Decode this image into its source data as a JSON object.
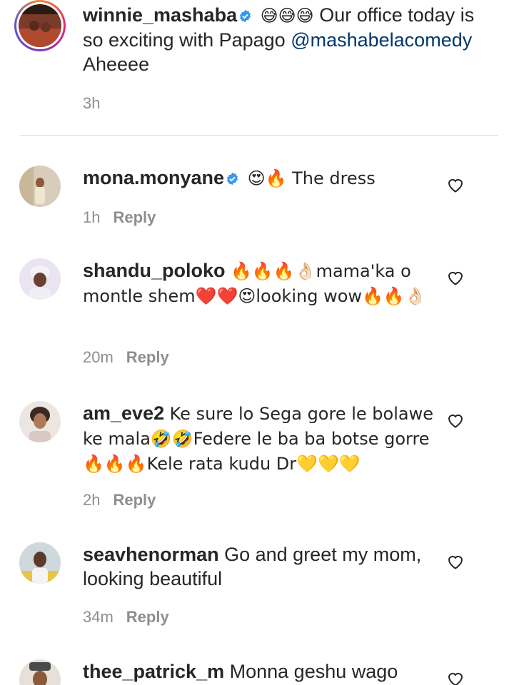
{
  "caption": {
    "username": "winnie_mashaba",
    "emojis": "😅😅😅",
    "text_before_mention": "Our office today is so exciting with Papago",
    "mention": "@mashabelacomedy",
    "text_after_mention": "Aheeee",
    "time": "3h",
    "verified": true
  },
  "comments": [
    {
      "username": "mona.monyane",
      "verified": true,
      "text": "😍🔥 The dress",
      "time": "1h",
      "reply_label": "Reply"
    },
    {
      "username": "shandu_poloko",
      "verified": false,
      "text": "🔥🔥🔥👌🏻mama'ka o montle shem❤️❤️😍looking wow🔥🔥👌🏻",
      "time": "20m",
      "reply_label": "Reply"
    },
    {
      "username": "am_eve2",
      "verified": false,
      "text": "Ke sure lo Sega gore le bolawe ke mala🤣🤣Federe le ba ba botse gorre 🔥🔥🔥Kele rata kudu Dr💛💛💛",
      "time": "2h",
      "reply_label": "Reply"
    },
    {
      "username": "seavhenorman",
      "verified": false,
      "text": "Go and greet my mom, looking beautiful",
      "time": "34m",
      "reply_label": "Reply"
    },
    {
      "username": "thee_patrick_m",
      "verified": false,
      "text": "Monna geshu wago",
      "time": "",
      "reply_label": ""
    }
  ],
  "colors": {
    "verified_blue": "#3897f0",
    "muted": "#8e8e8e",
    "mention": "#00376b"
  },
  "icons": {
    "like": "heart-outline-icon",
    "verified": "verified-badge-icon"
  }
}
